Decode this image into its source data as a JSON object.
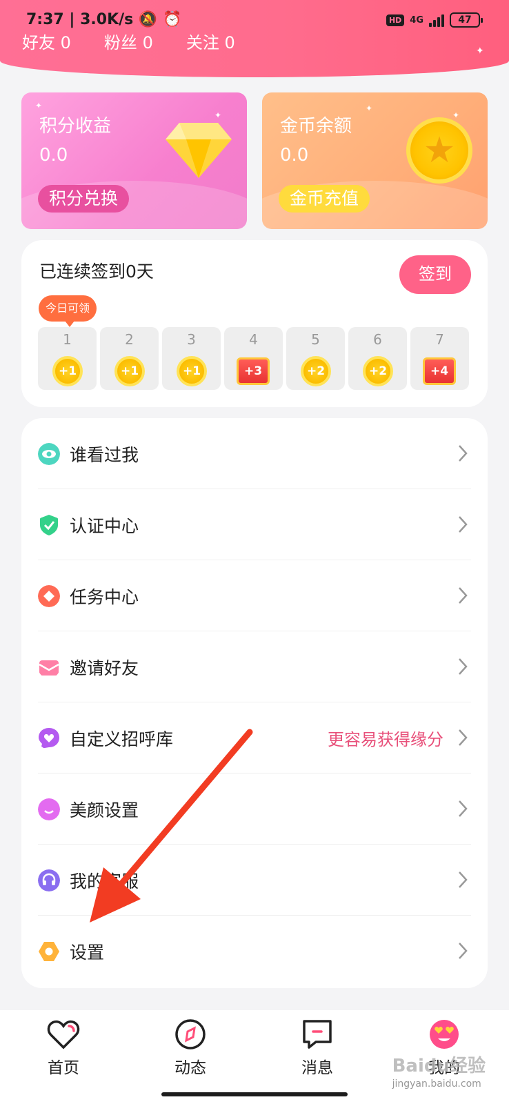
{
  "status_bar": {
    "time": "7:37",
    "net_speed": "3.0K/s",
    "hd": "HD",
    "network": "4G",
    "battery": "47"
  },
  "profile_stats": [
    {
      "label": "好友",
      "value": "0"
    },
    {
      "label": "粉丝",
      "value": "0"
    },
    {
      "label": "关注",
      "value": "0"
    }
  ],
  "points_card": {
    "title": "积分收益",
    "value": "0.0",
    "button": "积分兑换",
    "icon": "diamond-icon"
  },
  "coin_card": {
    "title": "金币余额",
    "value": "0.0",
    "button": "金币充值",
    "icon": "gold-coin-icon"
  },
  "sign_in": {
    "title": "已连续签到0天",
    "button": "签到",
    "today_tip": "今日可领",
    "days": [
      {
        "day": "1",
        "reward": "+1",
        "kind": "coin"
      },
      {
        "day": "2",
        "reward": "+1",
        "kind": "coin"
      },
      {
        "day": "3",
        "reward": "+1",
        "kind": "coin"
      },
      {
        "day": "4",
        "reward": "+3",
        "kind": "chest"
      },
      {
        "day": "5",
        "reward": "+2",
        "kind": "coin"
      },
      {
        "day": "6",
        "reward": "+2",
        "kind": "coin"
      },
      {
        "day": "7",
        "reward": "+4",
        "kind": "chest"
      }
    ]
  },
  "menu": [
    {
      "label": "谁看过我",
      "icon": "eye-icon",
      "color": "#4dd6c0"
    },
    {
      "label": "认证中心",
      "icon": "shield-check-icon",
      "color": "#33d18a"
    },
    {
      "label": "任务中心",
      "icon": "task-diamond-icon",
      "color": "#ff6a55"
    },
    {
      "label": "邀请好友",
      "icon": "envelope-icon",
      "color": "#ff7fa6"
    },
    {
      "label": "自定义招呼库",
      "icon": "heart-chat-icon",
      "color": "#b45af0",
      "hint": "更容易获得缘分"
    },
    {
      "label": "美颜设置",
      "icon": "smile-icon",
      "color": "#e36bf0"
    },
    {
      "label": "我的客服",
      "icon": "headset-icon",
      "color": "#8a6ef0"
    },
    {
      "label": "设置",
      "icon": "hexagon-gear-icon",
      "color": "#ffb33a"
    }
  ],
  "tabs": [
    {
      "label": "首页",
      "icon": "heart-outline-icon"
    },
    {
      "label": "动态",
      "icon": "compass-icon"
    },
    {
      "label": "消息",
      "icon": "message-icon"
    },
    {
      "label": "我的",
      "icon": "love-face-icon"
    }
  ],
  "watermark": {
    "brand": "Baidu经验",
    "url": "jingyan.baidu.com"
  },
  "colors": {
    "accent": "#ff6288",
    "header": "#ff6f95",
    "hint": "#e8507a"
  }
}
